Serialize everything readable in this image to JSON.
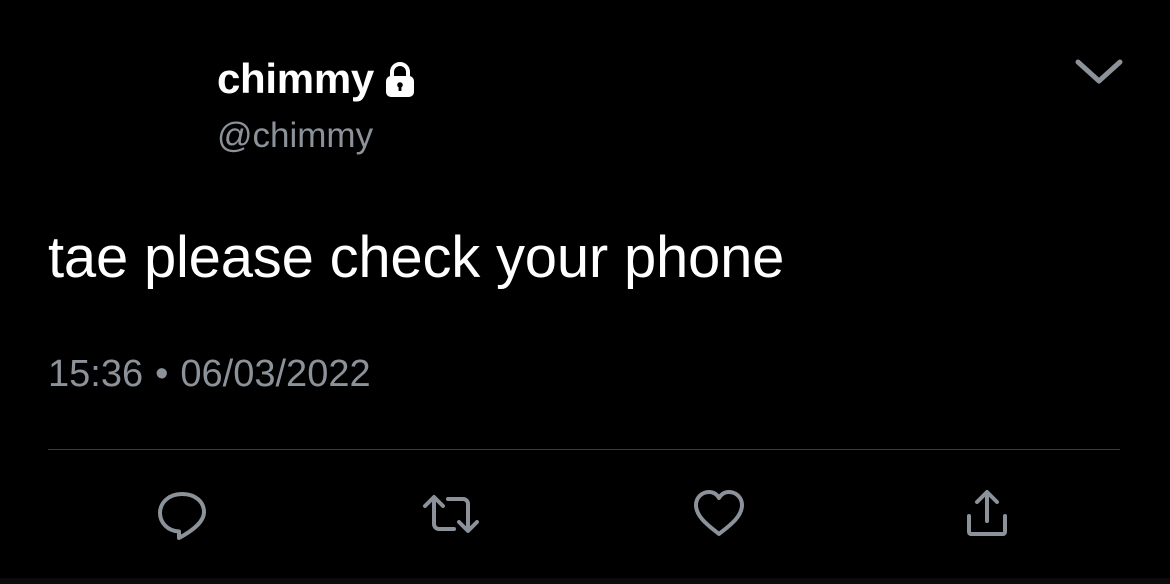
{
  "tweet": {
    "display_name": "chimmy",
    "handle": "@chimmy",
    "text": "tae please check your phone",
    "time": "15:36",
    "separator": "•",
    "date": "06/03/2022",
    "protected_icon": "lock-icon",
    "menu_icon": "chevron-down-icon"
  },
  "actions": [
    {
      "icon": "reply-icon"
    },
    {
      "icon": "retweet-icon"
    },
    {
      "icon": "like-icon"
    },
    {
      "icon": "share-icon"
    }
  ],
  "colors": {
    "background": "#000000",
    "primary_text": "#ffffff",
    "secondary_text": "#8b9299",
    "divider": "#3a3d41"
  }
}
